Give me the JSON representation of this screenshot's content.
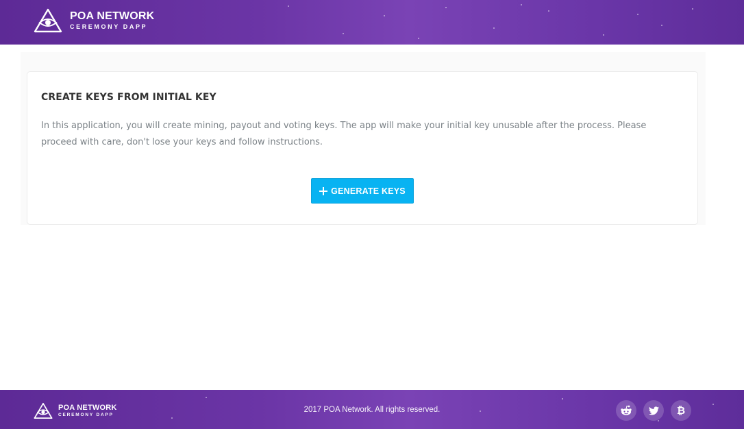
{
  "header": {
    "brand_title": "POA NETWORK",
    "brand_subtitle": "CEREMONY DAPP",
    "logo_icon": "eye-in-triangle-icon",
    "background_color": "#6b35a6"
  },
  "card": {
    "title": "CREATE KEYS FROM INITIAL KEY",
    "description": "In this application, you will create mining, payout and voting keys. The app will make your initial key unusable after the process. Please proceed with care, don't lose your keys and follow instructions.",
    "button_label": "GENERATE KEYS",
    "button_icon": "plus-icon",
    "button_color": "#08b3f2"
  },
  "footer": {
    "brand_title": "POA NETWORK",
    "brand_subtitle": "CEREMONY DAPP",
    "copyright": "2017 POA Network. All rights reserved.",
    "social_icons": [
      "reddit-icon",
      "twitter-icon",
      "bitcoin-icon"
    ]
  }
}
